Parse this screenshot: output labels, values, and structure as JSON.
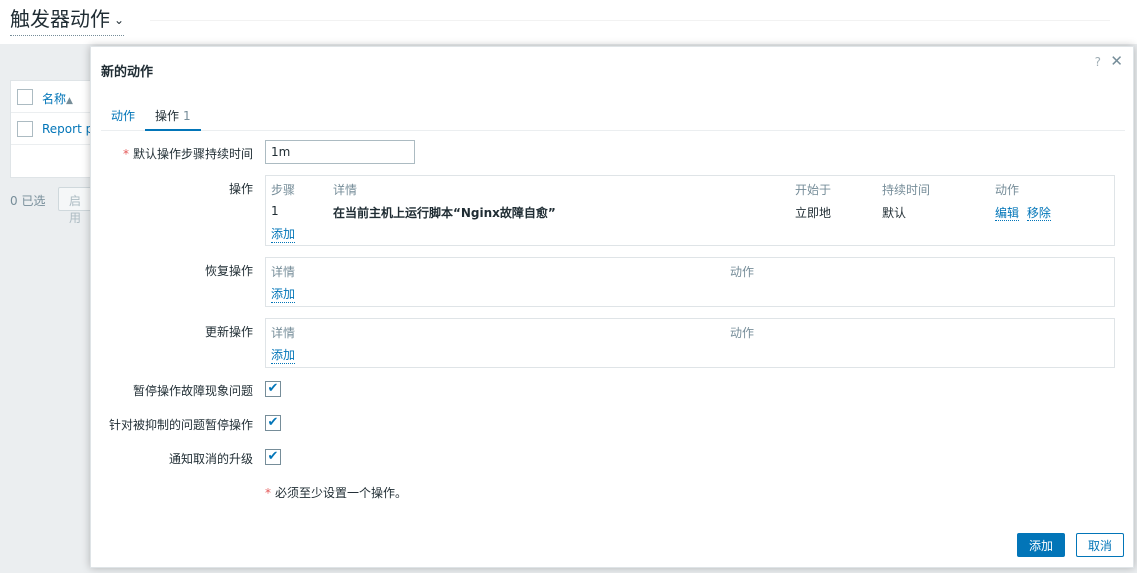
{
  "page": {
    "title": "触发器动作",
    "table": {
      "col_name": "名称",
      "row1_name": "Report p"
    },
    "selected_count": "0 已选",
    "enable_button": "启用"
  },
  "dialog": {
    "title": "新的动作",
    "help": "?",
    "close": "✕",
    "tabs": [
      {
        "label": "动作"
      },
      {
        "label": "操作",
        "count": "1"
      }
    ],
    "default_step_duration": {
      "label": "默认操作步骤持续时间",
      "value": "1m"
    },
    "operations": {
      "label": "操作",
      "headers": [
        "步骤",
        "详情",
        "开始于",
        "持续时间",
        "动作"
      ],
      "rows": [
        {
          "step": "1",
          "details": "在当前主机上运行脚本“Nginx故障自愈”",
          "start": "立即地",
          "duration": "默认",
          "edit": "编辑",
          "remove": "移除"
        }
      ],
      "add": "添加"
    },
    "recovery_operations": {
      "label": "恢复操作",
      "headers": [
        "详情",
        "动作"
      ],
      "add": "添加"
    },
    "update_operations": {
      "label": "更新操作",
      "headers": [
        "详情",
        "动作"
      ],
      "add": "添加"
    },
    "checkboxes": [
      {
        "label": "暂停操作故障现象问题",
        "checked": true
      },
      {
        "label": "针对被抑制的问题暂停操作",
        "checked": true
      },
      {
        "label": "通知取消的升级",
        "checked": true
      }
    ],
    "note": "必须至少设置一个操作。",
    "buttons": {
      "add": "添加",
      "cancel": "取消"
    }
  },
  "colors": {
    "accent": "#0275b8",
    "required": "#e45959"
  },
  "icons": {
    "check": "✔",
    "sort_up": "▲",
    "chevron_down": "⌄"
  }
}
